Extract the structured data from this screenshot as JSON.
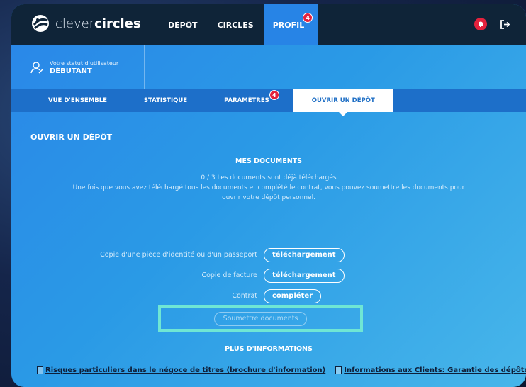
{
  "app": {
    "logo_light": "clever",
    "logo_bold": "circles"
  },
  "nav": {
    "items": [
      {
        "label": "DÉPÔT"
      },
      {
        "label": "CIRCLES"
      },
      {
        "label": "PROFIL",
        "active": true,
        "badge": "4"
      }
    ]
  },
  "status": {
    "label": "Votre statut d'utilisateur",
    "value": "DÉBUTANT"
  },
  "subnav": {
    "items": [
      {
        "label": "VUE D'ENSEMBLE"
      },
      {
        "label": "STATISTIQUE"
      },
      {
        "label": "PARAMÈTRES",
        "badge": "4"
      },
      {
        "label": "OUVRIR UN DÉPÔT",
        "active": true
      }
    ]
  },
  "main": {
    "section_title": "OUVRIR UN DÉPÔT",
    "docs_title": "MES DOCUMENTS",
    "info_line1": "0 / 3 Les documents sont déjà téléchargés",
    "info_line2": "Une fois que vous avez téléchargé tous les documents et complété le contrat, vous pouvez soumettre les documents pour ouvrir votre dépôt personnel.",
    "rows": [
      {
        "label": "Copie d'une pièce d'identité ou d'un passeport",
        "button": "téléchargement"
      },
      {
        "label": "Copie de facture",
        "button": "téléchargement"
      },
      {
        "label": "Contrat",
        "button": "compléter"
      }
    ],
    "submit_label": "Soumettre documents",
    "more_title": "PLUS D'INFORMATIONS",
    "links": [
      {
        "label": "Risques particuliers dans le négoce de titres (brochure d'information)"
      },
      {
        "label": "Informations aux Clients: Garantie des dépôts"
      }
    ]
  },
  "colors": {
    "accent": "#2784e6",
    "topbar": "#0f2438",
    "badge": "#e3223d",
    "highlight": "#6fe6d4"
  }
}
